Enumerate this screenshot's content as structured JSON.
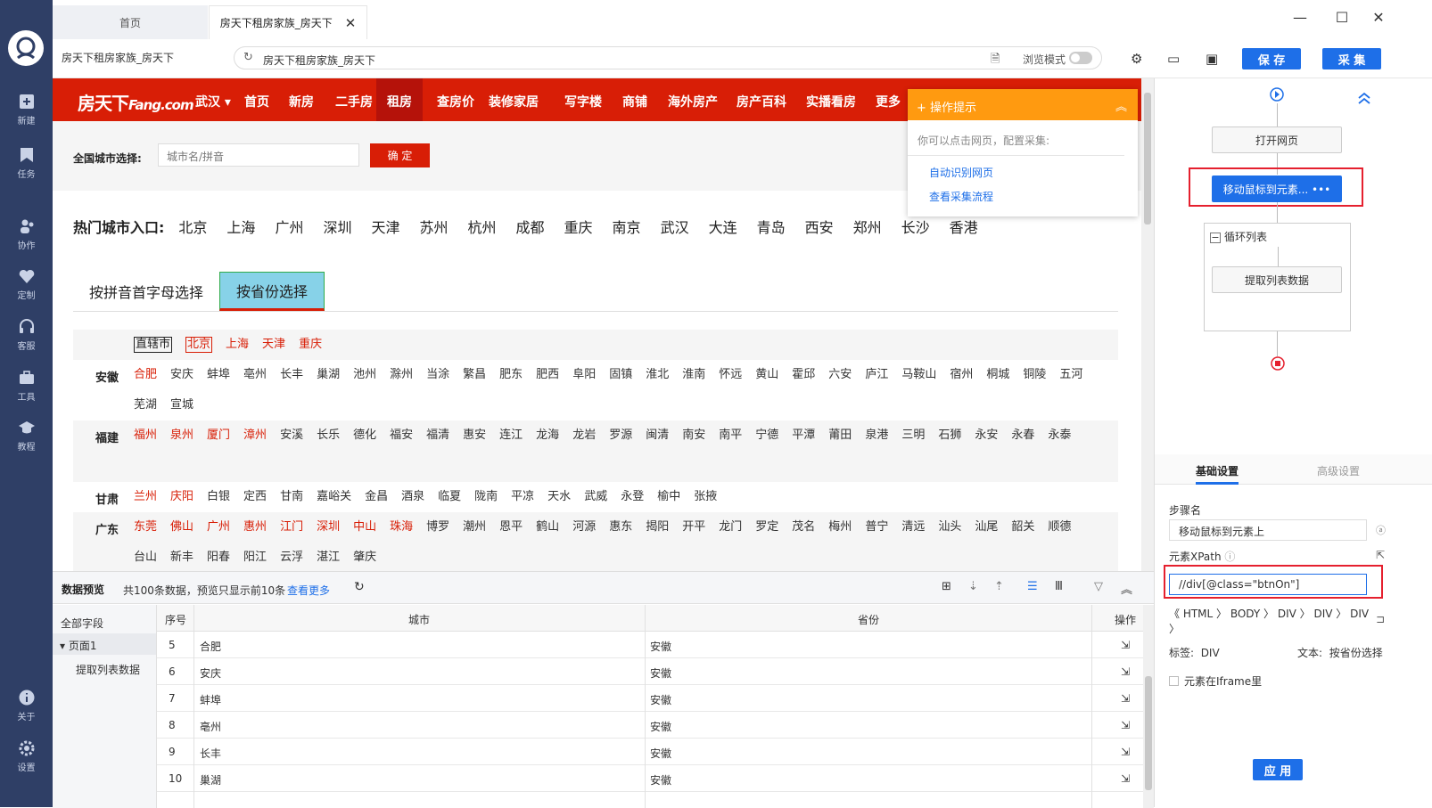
{
  "sidebar": {
    "items": [
      {
        "label": "新建",
        "icon": "plus-square-icon"
      },
      {
        "label": "任务",
        "icon": "bookmark-icon"
      },
      {
        "label": "协作",
        "icon": "users-icon"
      },
      {
        "label": "定制",
        "icon": "heart-check-icon"
      },
      {
        "label": "客服",
        "icon": "headset-icon"
      },
      {
        "label": "工具",
        "icon": "briefcase-icon"
      },
      {
        "label": "教程",
        "icon": "graduation-cap-icon"
      }
    ],
    "bottom": [
      {
        "label": "关于",
        "icon": "info-icon"
      },
      {
        "label": "设置",
        "icon": "gear-icon"
      }
    ]
  },
  "tabs": [
    {
      "label": "首页"
    },
    {
      "label": "房天下租房家族_房天下"
    }
  ],
  "addressbar": {
    "page_name": "房天下租房家族_房天下",
    "url": "房天下租房家族_房天下",
    "mode_label": "浏览模式"
  },
  "toolbar": {
    "save_label": "保 存",
    "collect_label": "采 集"
  },
  "site": {
    "brand": "房天下",
    "brand_suffix": "Fang.com",
    "city": "武汉",
    "nav": [
      "首页",
      "新房",
      "二手房",
      "租房",
      "查房价",
      "装修家居",
      "写字楼",
      "商铺",
      "海外房产",
      "房产百科",
      "实播看房",
      "更多"
    ],
    "city_select_label": "全国城市选择:",
    "city_input_placeholder": "城市名/拼音",
    "confirm_label": "确 定",
    "hot_label": "热门城市入口:",
    "hot_cities": [
      "北京",
      "上海",
      "广州",
      "深圳",
      "天津",
      "苏州",
      "杭州",
      "成都",
      "重庆",
      "南京",
      "武汉",
      "大连",
      "青岛",
      "西安",
      "郑州",
      "长沙",
      "香港"
    ],
    "tab_pinyin": "按拼音首字母选择",
    "tab_province": "按省份选择",
    "municipality": {
      "label": "直辖市",
      "cities": [
        "北京",
        "上海",
        "天津",
        "重庆"
      ]
    },
    "provinces": [
      {
        "name": "安徽",
        "red": [
          "合肥"
        ],
        "cities": [
          "安庆",
          "蚌埠",
          "亳州",
          "长丰",
          "巢湖",
          "池州",
          "滁州",
          "当涂",
          "繁昌",
          "肥东",
          "肥西",
          "阜阳",
          "固镇",
          "淮北",
          "淮南",
          "怀远",
          "黄山",
          "霍邱",
          "六安",
          "庐江",
          "马鞍山",
          "宿州",
          "桐城",
          "铜陵",
          "五河",
          "芜湖",
          "宣城"
        ]
      },
      {
        "name": "福建",
        "red": [
          "福州",
          "泉州",
          "厦门",
          "漳州"
        ],
        "cities": [
          "安溪",
          "长乐",
          "德化",
          "福安",
          "福清",
          "惠安",
          "连江",
          "龙海",
          "龙岩",
          "罗源",
          "闽清",
          "南安",
          "南平",
          "宁德",
          "平潭",
          "莆田",
          "泉港",
          "三明",
          "石狮",
          "永安",
          "永春",
          "永泰"
        ]
      },
      {
        "name": "甘肃",
        "red": [
          "兰州",
          "庆阳"
        ],
        "cities": [
          "白银",
          "定西",
          "甘南",
          "嘉峪关",
          "金昌",
          "酒泉",
          "临夏",
          "陇南",
          "平凉",
          "天水",
          "武威",
          "永登",
          "榆中",
          "张掖"
        ]
      },
      {
        "name": "广东",
        "red": [
          "东莞",
          "佛山",
          "广州",
          "惠州",
          "江门",
          "深圳",
          "中山",
          "珠海"
        ],
        "cities": [
          "博罗",
          "潮州",
          "恩平",
          "鹤山",
          "河源",
          "惠东",
          "揭阳",
          "开平",
          "龙门",
          "罗定",
          "茂名",
          "梅州",
          "普宁",
          "清远",
          "汕头",
          "汕尾",
          "韶关",
          "顺德",
          "台山",
          "新丰",
          "阳春",
          "阳江",
          "云浮",
          "湛江",
          "肇庆"
        ]
      }
    ]
  },
  "tips": {
    "title": "+ 操作提示",
    "subtitle": "你可以点击网页，配置采集:",
    "links": [
      "自动识别网页",
      "查看采集流程"
    ]
  },
  "preview": {
    "title": "数据预览",
    "info": "共100条数据，预览只显示前10条",
    "more": "查看更多",
    "tree": {
      "all": "全部字段",
      "page": "页面1",
      "step": "提取列表数据"
    },
    "columns": [
      "序号",
      "城市",
      "省份",
      "操作"
    ],
    "rows": [
      {
        "n": "5",
        "city": "合肥",
        "prov": "安徽"
      },
      {
        "n": "6",
        "city": "安庆",
        "prov": "安徽"
      },
      {
        "n": "7",
        "city": "蚌埠",
        "prov": "安徽"
      },
      {
        "n": "8",
        "city": "亳州",
        "prov": "安徽"
      },
      {
        "n": "9",
        "city": "长丰",
        "prov": "安徽"
      },
      {
        "n": "10",
        "city": "巢湖",
        "prov": "安徽"
      }
    ]
  },
  "flow": {
    "open": "打开网页",
    "move": "移动鼠标到元素... •••",
    "loop": "循环列表",
    "extract": "提取列表数据"
  },
  "settings": {
    "tab_basic": "基础设置",
    "tab_adv": "高级设置",
    "step_name_label": "步骤名",
    "step_name": "移动鼠标到元素上",
    "xpath_label": "元素XPath",
    "xpath": "//div[@class=\"btnOn\"]",
    "crumbs": "《 HTML 〉 BODY 〉 DIV 〉 DIV 〉 DIV 〉",
    "tag_label": "标签:",
    "tag": "DIV",
    "text_label": "文本:",
    "text": "按省份选择",
    "iframe_label": "元素在Iframe里",
    "apply": "应 用"
  }
}
